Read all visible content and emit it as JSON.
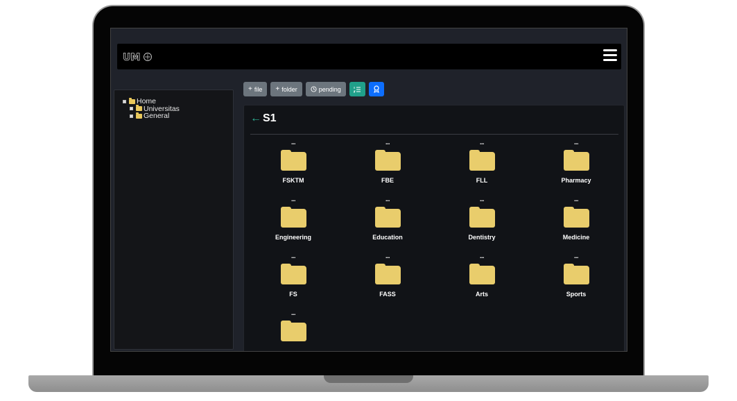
{
  "app": {
    "brand": "UM"
  },
  "tree": {
    "root": "Home",
    "children": [
      "Universitas",
      "General"
    ]
  },
  "toolbar": {
    "file_label": "file",
    "folder_label": "folder",
    "pending_label": "pending"
  },
  "panel": {
    "back_arrow": "←",
    "title": "S1",
    "more": "...",
    "folders": [
      "FSKTM",
      "FBE",
      "FLL",
      "Pharmacy",
      "Engineering",
      "Education",
      "Dentistry",
      "Medicine",
      "FS",
      "FASS",
      "Arts",
      "Sports",
      ""
    ]
  },
  "colors": {
    "folder": "#e9cd6c",
    "accent_teal": "#20a08a",
    "accent_blue": "#0d6efd",
    "button_gray": "#6c757d"
  }
}
